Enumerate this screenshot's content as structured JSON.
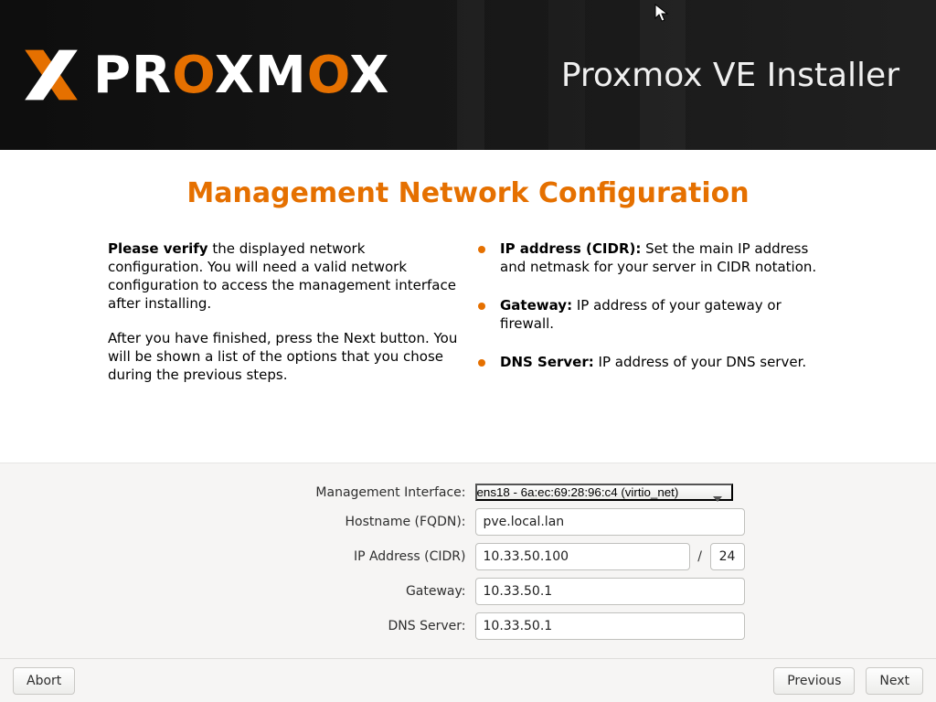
{
  "brand": {
    "name_left": "PR",
    "name_ox1": "O",
    "name_mid": "XM",
    "name_ox2": "O",
    "name_end": "X"
  },
  "installer_title": "Proxmox VE Installer",
  "page_title": "Management Network Configuration",
  "intro": {
    "p1_strong": "Please verify",
    "p1_rest": " the displayed network configuration. You will need a valid network configuration to access the management interface after installing.",
    "p2": "After you have finished, press the Next button. You will be shown a list of the options that you chose during the previous steps."
  },
  "bullets": [
    {
      "label": "IP address (CIDR):",
      "text": " Set the main IP address and netmask for your server in CIDR notation."
    },
    {
      "label": "Gateway:",
      "text": " IP address of your gateway or firewall."
    },
    {
      "label": "DNS Server:",
      "text": " IP address of your DNS server."
    }
  ],
  "form": {
    "mgmt_label": "Management Interface:",
    "mgmt_value": "ens18 - 6a:ec:69:28:96:c4 (virtio_net)",
    "hostname_label": "Hostname (FQDN):",
    "hostname_value": "pve.local.lan",
    "ip_label": "IP Address (CIDR)",
    "ip_value": "10.33.50.100",
    "cidr_sep": "/",
    "cidr_value": "24",
    "gw_label": "Gateway:",
    "gw_value": "10.33.50.1",
    "dns_label": "DNS Server:",
    "dns_value": "10.33.50.1"
  },
  "buttons": {
    "abort": "Abort",
    "previous": "Previous",
    "next": "Next"
  }
}
